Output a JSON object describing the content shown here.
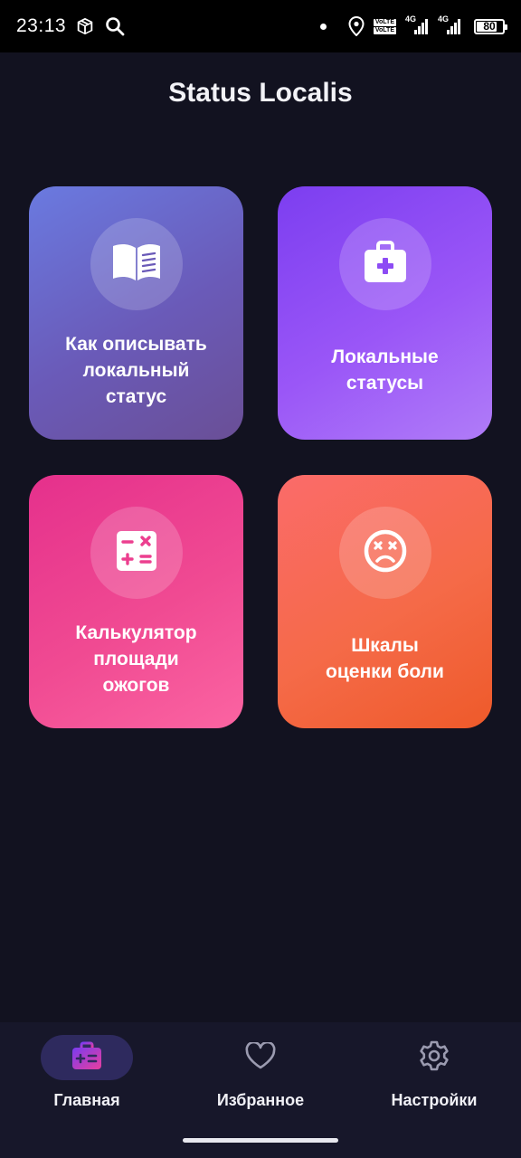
{
  "status_bar": {
    "time": "23:13",
    "volte_1": "VoLTE",
    "volte_2": "VoLTE",
    "net_1": "4G",
    "net_2": "4G",
    "battery": "80",
    "battery_level": 0.8,
    "icons": [
      "box-icon",
      "search-icon",
      "dot-icon",
      "location-icon",
      "signal-icon",
      "battery-icon"
    ]
  },
  "app": {
    "title": "Status Localis"
  },
  "cards": [
    {
      "label": "Как описывать\nлокальный\nстатус",
      "icon": "book-icon",
      "gradient": [
        "#6a7ae0",
        "#6a4f96"
      ]
    },
    {
      "label": "Локальные\nстатусы",
      "icon": "first-aid-kit-icon",
      "gradient": [
        "#7c3ef0",
        "#b07cf8"
      ]
    },
    {
      "label": "Калькулятор\nплощади\nожогов",
      "icon": "calculator-icon",
      "gradient": [
        "#e5308c",
        "#fb64a2"
      ]
    },
    {
      "label": "Шкалы\nоценки боли",
      "icon": "dizzy-face-icon",
      "gradient": [
        "#fb6b6a",
        "#ee5a2a"
      ]
    }
  ],
  "bottom_nav": {
    "items": [
      {
        "label": "Главная",
        "icon": "home-kit-icon",
        "active": true
      },
      {
        "label": "Избранное",
        "icon": "heart-icon",
        "active": false
      },
      {
        "label": "Настройки",
        "icon": "gear-icon",
        "active": false
      }
    ]
  },
  "colors": {
    "background": "#121220",
    "nav_background": "#17172a",
    "nav_active_pill": "#2e2a5e",
    "accent_active": "#c03cd8"
  }
}
